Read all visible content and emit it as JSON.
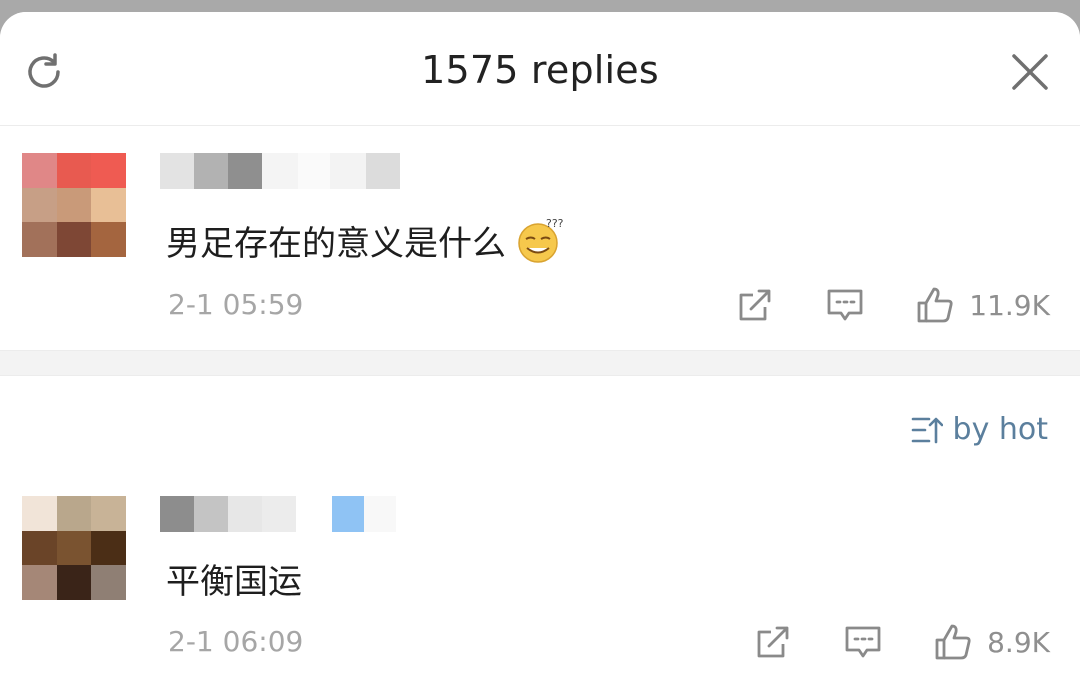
{
  "header": {
    "title": "1575 replies",
    "refresh_icon": "refresh-icon",
    "close_icon": "close-icon"
  },
  "main_comment": {
    "text": "男足存在的意义是什么",
    "emoji": "thinking-smile-emoji",
    "timestamp": "2-1 05:59",
    "likes": "11.9K"
  },
  "sort": {
    "label": "by hot",
    "icon": "sort-icon"
  },
  "replies": [
    {
      "text": "平衡国运",
      "timestamp": "2-1 06:09",
      "likes": "8.9K"
    }
  ],
  "colors": {
    "accent_link": "#5b7f9d",
    "muted_text": "#a6a6a6"
  }
}
